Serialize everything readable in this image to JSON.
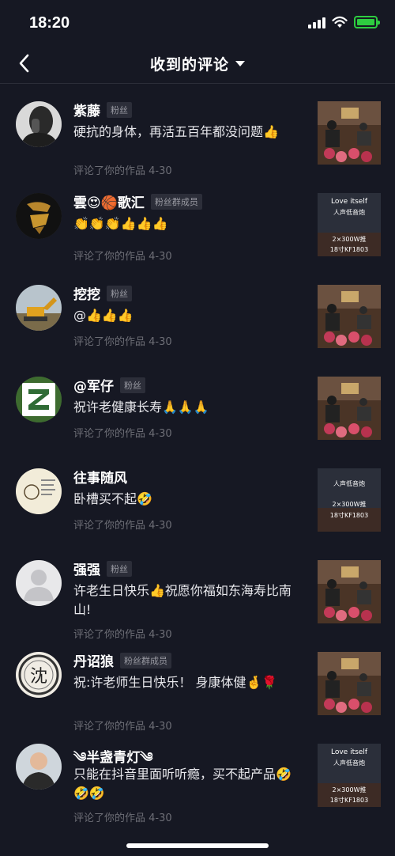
{
  "status": {
    "time": "18:20"
  },
  "nav": {
    "title": "收到的评论"
  },
  "comments": [
    {
      "name": "紫藤",
      "badge": "粉丝",
      "text": "硬抗的身体，再活五百年都没问题👍",
      "meta": "评论了你的作品  4-30"
    },
    {
      "name": "雲😍🏀歌汇",
      "badge": "粉丝群成员",
      "text": "👏👏👏👍👍👍",
      "meta": "评论了你的作品  4-30"
    },
    {
      "name": "挖挖",
      "badge": "粉丝",
      "text": "@👍👍👍",
      "meta": "评论了你的作品  4-30"
    },
    {
      "name": "@军仔",
      "badge": "粉丝",
      "text": "祝许老健康长寿🙏🙏🙏",
      "meta": "评论了你的作品  4-30"
    },
    {
      "name": "往事随风",
      "badge": "",
      "text": "卧槽买不起🤣",
      "meta": "评论了你的作品  4-30"
    },
    {
      "name": "强强",
      "badge": "粉丝",
      "text": "许老生日快乐👍祝愿你福如东海寿比南山!",
      "meta": "评论了你的作品  4-30"
    },
    {
      "name": "丹诏狼",
      "badge": "粉丝群成员",
      "text": "祝:许老师生日快乐！ 身康体健🤞🌹",
      "meta": "评论了你的作品  4-30"
    },
    {
      "name": "༄半盏青灯༄",
      "badge": "",
      "text": "只能在抖音里面听听瘾，买不起产品🤣🤣🤣",
      "meta": "评论了你的作品  4-30"
    }
  ],
  "thumb_texts": {
    "a": [
      "Love itself",
      "人声低音炮",
      "2×300W推",
      "18寸KF1803"
    ],
    "b": [
      "人声低音炮",
      "2×300W推",
      "18寸KF1803"
    ]
  },
  "avatars": {
    "wuzheng": "沈"
  },
  "colors": {
    "background": "#161823",
    "meta": "#6d6e76",
    "badge_bg": "#2c2e39"
  }
}
